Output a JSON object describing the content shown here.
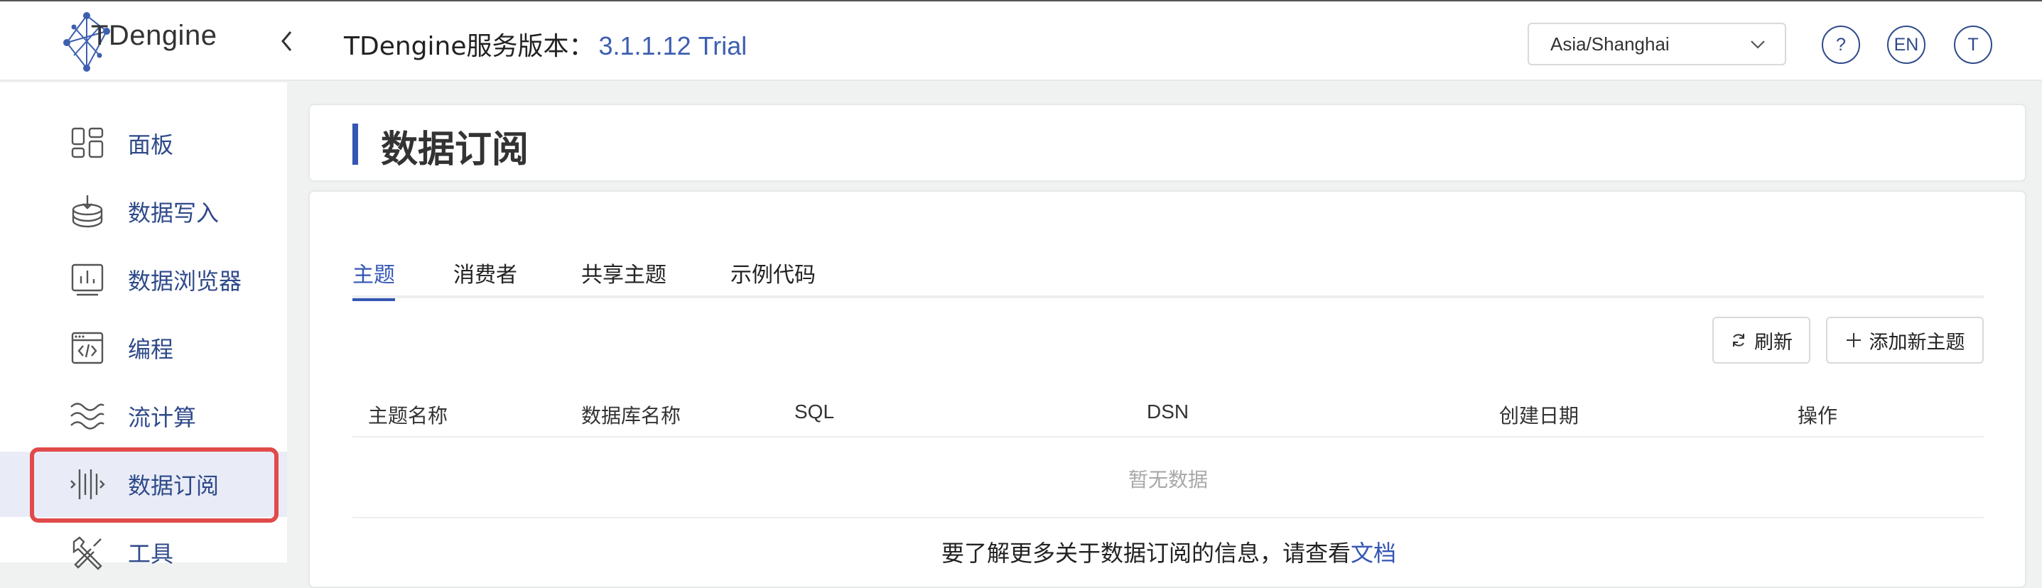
{
  "header": {
    "logo_text": "TDengine",
    "version_label": "TDengine服务版本：",
    "version_number": "3.1.1.12 Trial",
    "timezone": "Asia/Shanghai",
    "help_label": "?",
    "lang_label": "EN",
    "user_initial": "T"
  },
  "sidebar": {
    "items": [
      {
        "label": "面板",
        "icon": "dashboard-icon"
      },
      {
        "label": "数据写入",
        "icon": "data-ingest-icon"
      },
      {
        "label": "数据浏览器",
        "icon": "data-explorer-icon"
      },
      {
        "label": "编程",
        "icon": "code-icon"
      },
      {
        "label": "流计算",
        "icon": "stream-icon"
      },
      {
        "label": "数据订阅",
        "icon": "subscription-icon"
      },
      {
        "label": "工具",
        "icon": "tools-icon"
      }
    ],
    "active_index": 5
  },
  "page": {
    "title": "数据订阅",
    "tabs": [
      "主题",
      "消费者",
      "共享主题",
      "示例代码"
    ],
    "active_tab": 0,
    "refresh_label": "刷新",
    "add_topic_label": "添加新主题",
    "columns": [
      "主题名称",
      "数据库名称",
      "SQL",
      "DSN",
      "创建日期",
      "操作"
    ],
    "empty_text": "暂无数据",
    "footnote_prefix": "要了解更多关于数据订阅的信息，请查看",
    "footnote_link": "文档"
  },
  "colors": {
    "accent": "#3456b4",
    "nav_text": "#2f4a8a",
    "highlight": "#e04a4a"
  }
}
